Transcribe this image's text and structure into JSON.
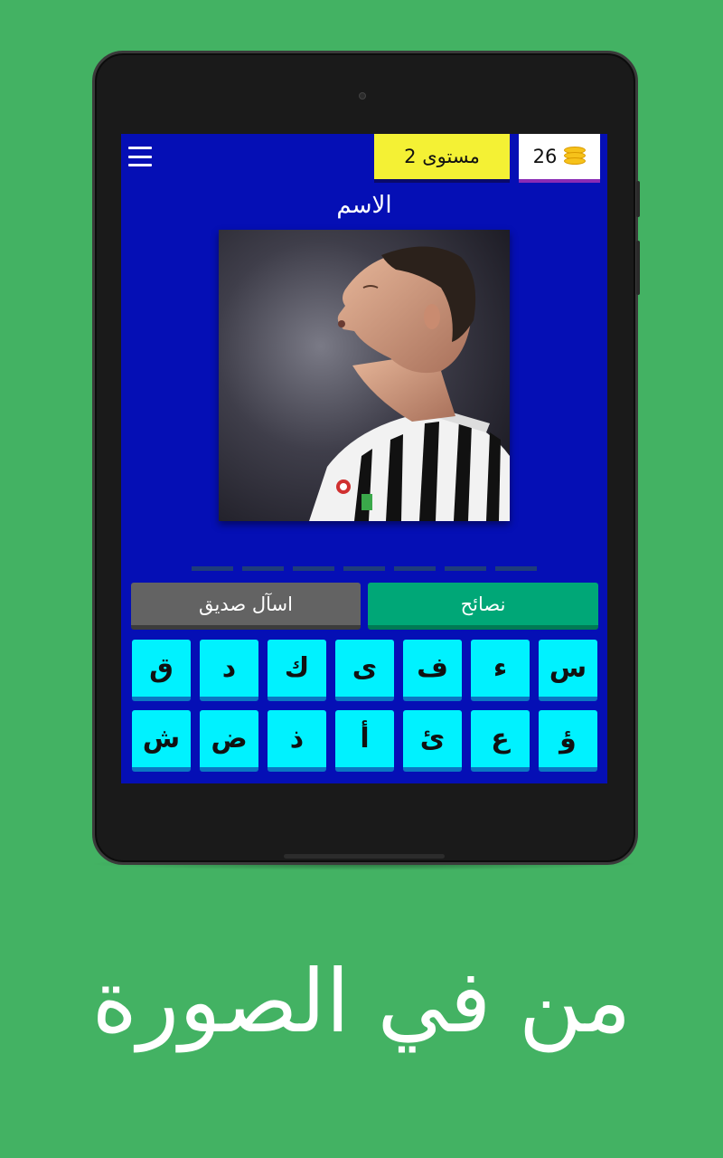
{
  "header": {
    "level_label": "مستوى 2",
    "coins": "26"
  },
  "prompt": {
    "title": "الاسم"
  },
  "answer": {
    "slot_count": 7
  },
  "actions": {
    "hints_label": "نصائح",
    "ask_friend_label": "اسآل صديق"
  },
  "keyboard": {
    "row1": [
      "س",
      "ء",
      "ف",
      "ى",
      "ك",
      "د",
      "ق"
    ],
    "row2": [
      "ؤ",
      "ع",
      "ئ",
      "أ",
      "ذ",
      "ض",
      "ش"
    ]
  },
  "promo": {
    "caption": "من في الصورة"
  },
  "colors": {
    "screen_bg": "#050fb5",
    "level_badge": "#f4f134",
    "hint_button": "#00a777",
    "ask_button": "#636363",
    "key_bg": "#00f2ff",
    "page_bg": "#43b263"
  },
  "icons": {
    "menu": "hamburger-menu-icon",
    "coins": "coin-stack-icon"
  }
}
